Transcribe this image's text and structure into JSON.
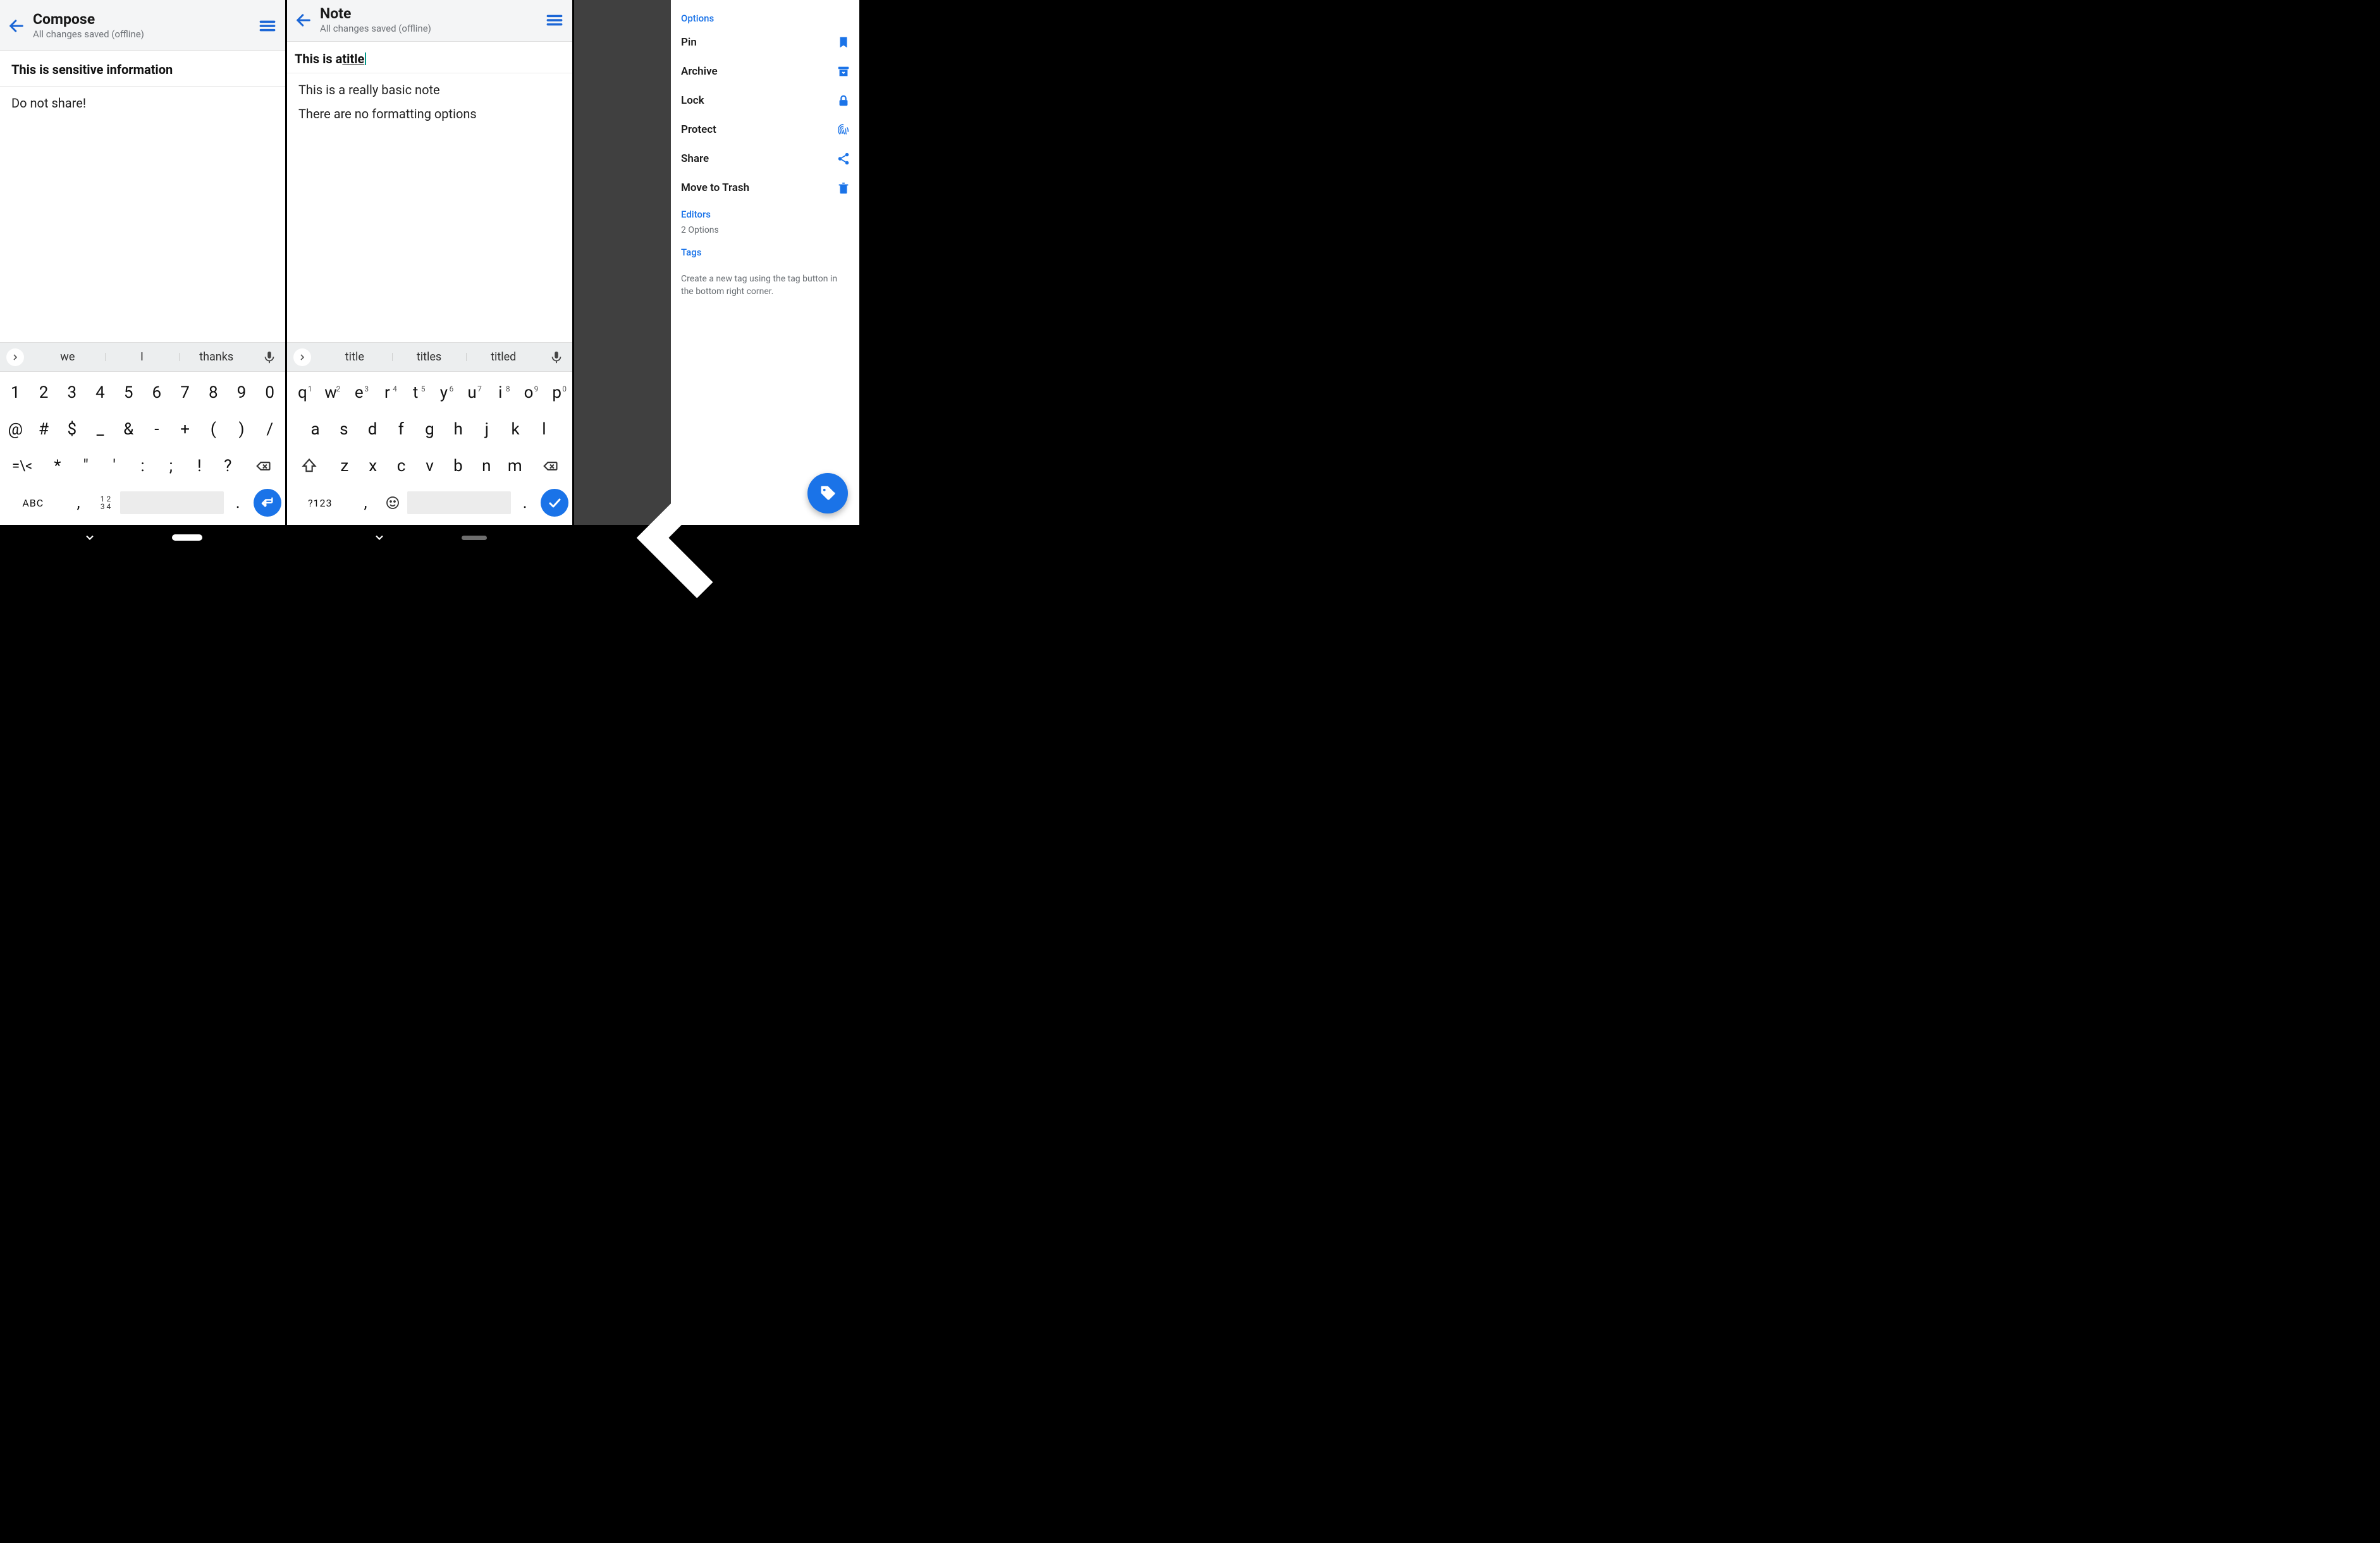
{
  "panel1": {
    "header": {
      "title": "Compose",
      "subtitle": "All changes saved (offline)"
    },
    "note_title": "This is sensitive information",
    "note_body": "Do not share!",
    "suggestions": [
      "we",
      "I",
      "thanks"
    ],
    "keyboard": {
      "row1": [
        "1",
        "2",
        "3",
        "4",
        "5",
        "6",
        "7",
        "8",
        "9",
        "0"
      ],
      "row2": [
        "@",
        "#",
        "$",
        "_",
        "&",
        "-",
        "+",
        "(",
        ")",
        "/"
      ],
      "row3": [
        "=\\<",
        "*",
        "\"",
        "'",
        ":",
        ";",
        "!",
        "?"
      ],
      "bottom": {
        "abc": "ABC",
        "comma": ",",
        "nums": "12\n34",
        "period": "."
      }
    }
  },
  "panel2": {
    "header": {
      "title": "Note",
      "subtitle": "All changes saved (offline)"
    },
    "note_title_prefix": "This is a ",
    "note_title_underlined": "title",
    "note_body_1": "This is a really basic note",
    "note_body_2": "There are no formatting options",
    "suggestions": [
      "title",
      "titles",
      "titled"
    ],
    "keyboard": {
      "row1": [
        {
          "k": "q",
          "s": "1"
        },
        {
          "k": "w",
          "s": "2"
        },
        {
          "k": "e",
          "s": "3"
        },
        {
          "k": "r",
          "s": "4"
        },
        {
          "k": "t",
          "s": "5"
        },
        {
          "k": "y",
          "s": "6"
        },
        {
          "k": "u",
          "s": "7"
        },
        {
          "k": "i",
          "s": "8"
        },
        {
          "k": "o",
          "s": "9"
        },
        {
          "k": "p",
          "s": "0"
        }
      ],
      "row2": [
        "a",
        "s",
        "d",
        "f",
        "g",
        "h",
        "j",
        "k",
        "l"
      ],
      "row3": [
        "z",
        "x",
        "c",
        "v",
        "b",
        "n",
        "m"
      ],
      "bottom": {
        "sym": "?123",
        "comma": ",",
        "period": "."
      }
    }
  },
  "panel3": {
    "options_heading": "Options",
    "options": [
      {
        "label": "Pin",
        "icon": "bookmark"
      },
      {
        "label": "Archive",
        "icon": "archive"
      },
      {
        "label": "Lock",
        "icon": "lock"
      },
      {
        "label": "Protect",
        "icon": "fingerprint"
      },
      {
        "label": "Share",
        "icon": "share"
      },
      {
        "label": "Move to Trash",
        "icon": "trash"
      }
    ],
    "editors_heading": "Editors",
    "editors_sub": "2 Options",
    "tags_heading": "Tags",
    "tags_hint": "Create a new tag using the tag button in the bottom right corner."
  }
}
